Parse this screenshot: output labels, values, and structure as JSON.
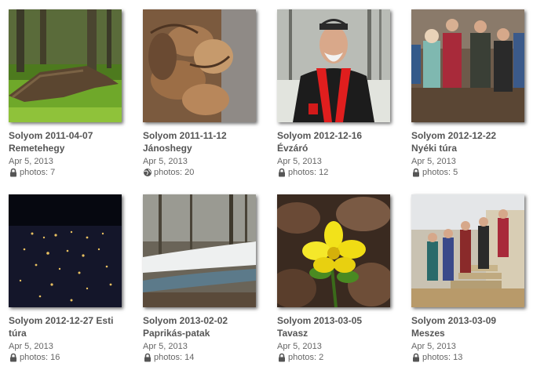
{
  "albums": [
    {
      "title_line1": "Solyom 2011-04-07",
      "title_line2": "Remetehegy",
      "date": "Apr 5, 2013",
      "photos": "photos: 7",
      "visibility_icon": "lock-icon"
    },
    {
      "title_line1": "Solyom 2011-11-12",
      "title_line2": "Jánoshegy",
      "date": "Apr 5, 2013",
      "photos": "photos: 20",
      "visibility_icon": "globe-icon"
    },
    {
      "title_line1": "Solyom 2012-12-16",
      "title_line2": "Évzáró",
      "date": "Apr 5, 2013",
      "photos": "photos: 12",
      "visibility_icon": "lock-icon"
    },
    {
      "title_line1": "Solyom 2012-12-22",
      "title_line2": "Nyéki túra",
      "date": "Apr 5, 2013",
      "photos": "photos: 5",
      "visibility_icon": "lock-icon"
    },
    {
      "title_line1": "Solyom 2012-12-27 Esti",
      "title_line2": "túra",
      "date": "Apr 5, 2013",
      "photos": "photos: 16",
      "visibility_icon": "lock-icon"
    },
    {
      "title_line1": "Solyom 2013-02-02",
      "title_line2": "Paprikás-patak",
      "date": "Apr 5, 2013",
      "photos": "photos: 14",
      "visibility_icon": "lock-icon"
    },
    {
      "title_line1": "Solyom 2013-03-05",
      "title_line2": "Tavasz",
      "date": "Apr 5, 2013",
      "photos": "photos: 2",
      "visibility_icon": "lock-icon"
    },
    {
      "title_line1": "Solyom 2013-03-09",
      "title_line2": "Meszes",
      "date": "Apr 5, 2013",
      "photos": "photos: 13",
      "visibility_icon": "lock-icon"
    }
  ]
}
